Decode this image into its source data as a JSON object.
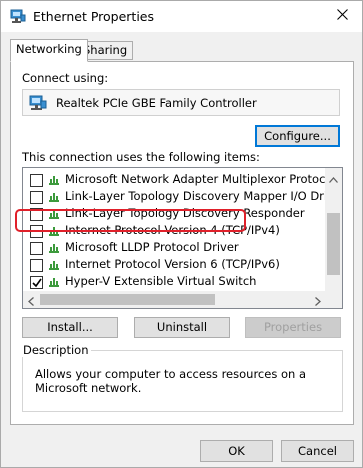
{
  "window": {
    "title": "Ethernet Properties",
    "close_icon": "close-icon",
    "title_icon": "network-adapter-icon"
  },
  "tabs": [
    {
      "label": "Networking",
      "active": true
    },
    {
      "label": "Sharing",
      "active": false
    }
  ],
  "connect_using": {
    "label": "Connect using:",
    "adapter": "Realtek PCIe GBE Family Controller",
    "configure_button": "Configure..."
  },
  "components": {
    "label": "This connection uses the following items:",
    "items": [
      {
        "label": "Microsoft Network Adapter Multiplexor Protocol",
        "checked": false
      },
      {
        "label": "Link-Layer Topology Discovery Mapper I/O Driver",
        "checked": false
      },
      {
        "label": "Link-Layer Topology Discovery Responder",
        "checked": false
      },
      {
        "label": "Internet Protocol Version 4 (TCP/IPv4)",
        "checked": false
      },
      {
        "label": "Microsoft LLDP Protocol Driver",
        "checked": false
      },
      {
        "label": "Internet Protocol Version 6 (TCP/IPv6)",
        "checked": false
      },
      {
        "label": "Hyper-V Extensible Virtual Switch",
        "checked": true
      }
    ],
    "install_button": "Install...",
    "uninstall_button": "Uninstall",
    "properties_button": "Properties"
  },
  "description": {
    "title": "Description",
    "text": "Allows your computer to access resources on a Microsoft network."
  },
  "footer": {
    "ok_button": "OK",
    "cancel_button": "Cancel"
  },
  "colors": {
    "highlight": "#e0202a",
    "focus": "#0078d7",
    "protocol_icon": "#3c9a3c"
  }
}
